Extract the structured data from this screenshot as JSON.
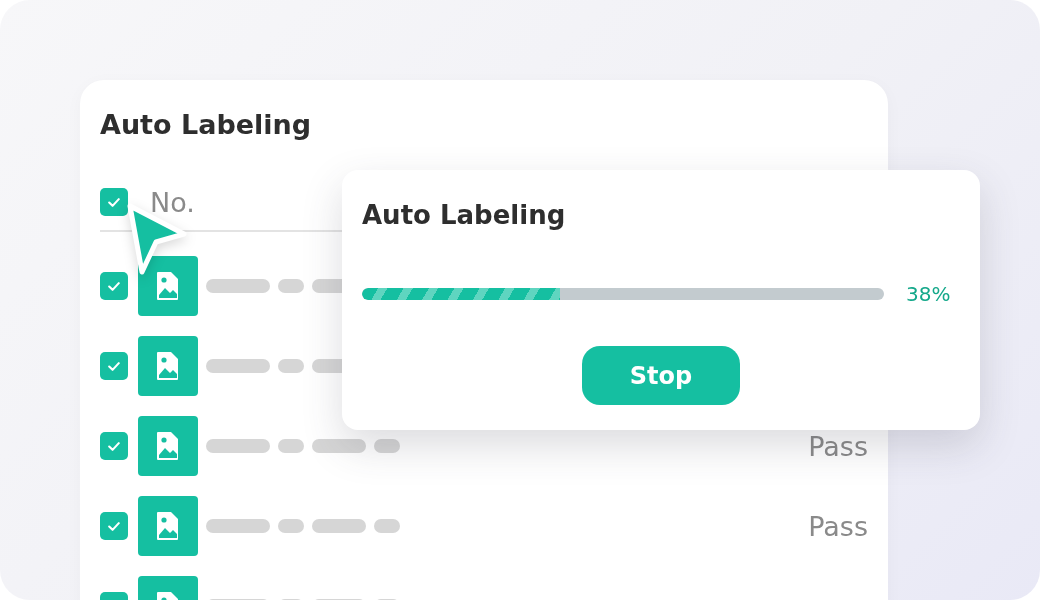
{
  "card": {
    "title": "Auto Labeling",
    "header": {
      "checked": true,
      "column": "No."
    },
    "rows": [
      {
        "checked": true
      },
      {
        "checked": true
      },
      {
        "checked": true,
        "status": "Pass"
      },
      {
        "checked": true,
        "status": "Pass"
      },
      {
        "checked": true
      }
    ]
  },
  "dialog": {
    "title": "Auto Labeling",
    "level": 0.38,
    "reading": "38%",
    "button": "Stop"
  }
}
